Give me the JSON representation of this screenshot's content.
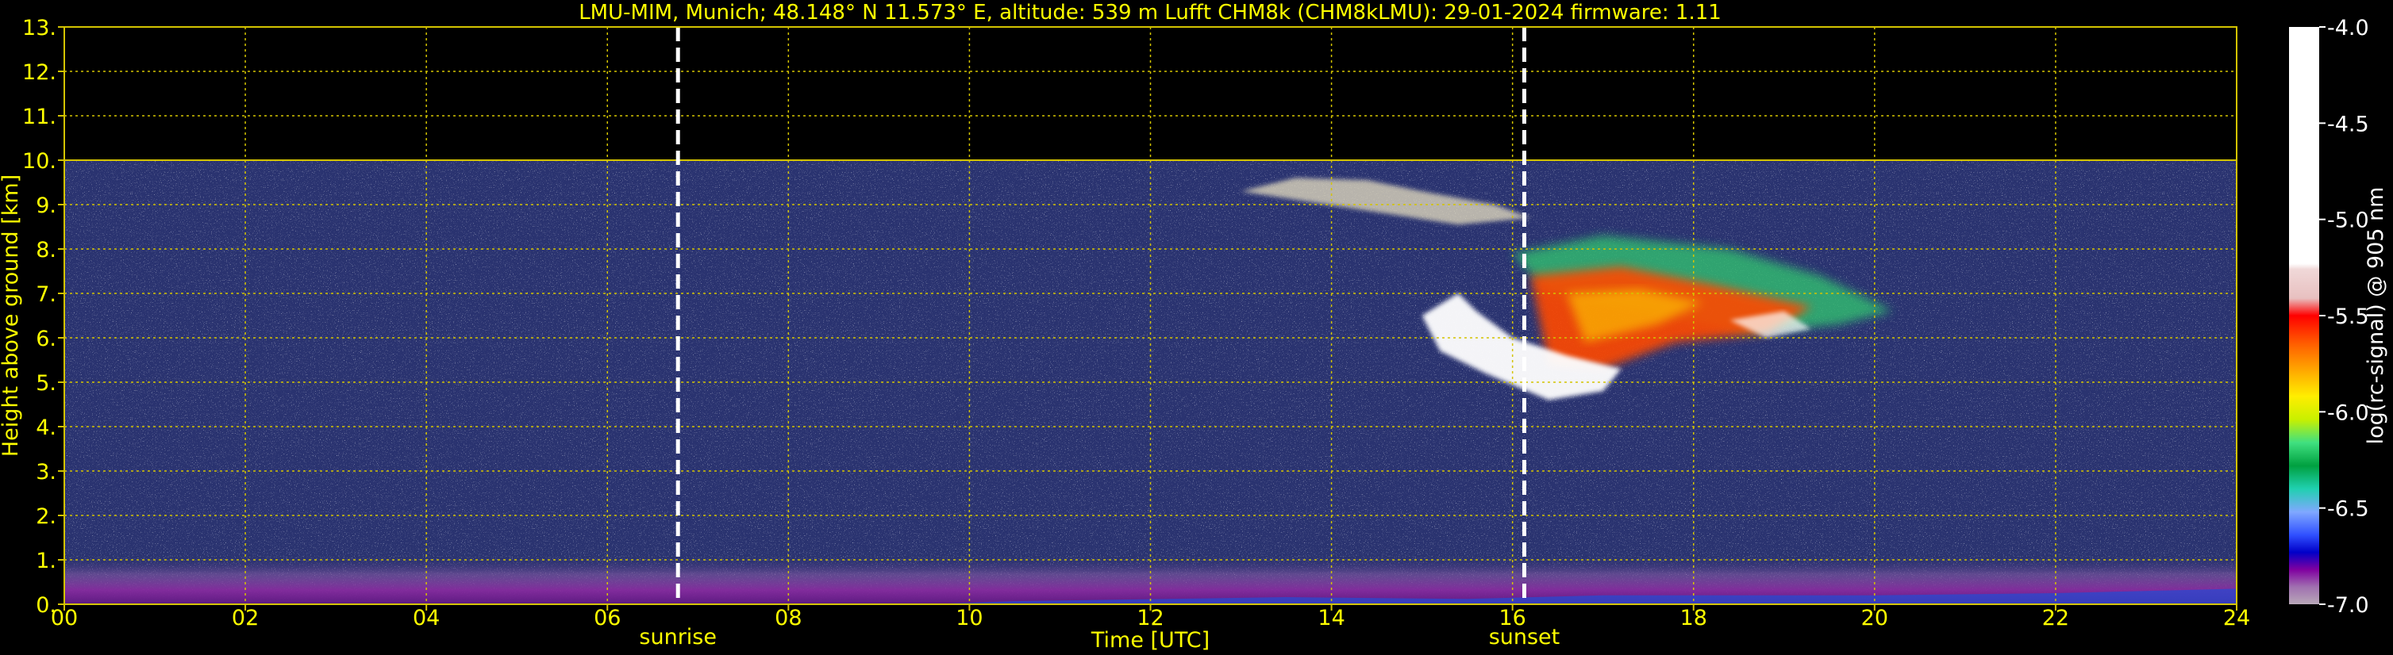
{
  "chart_data": {
    "type": "heatmap",
    "title": "LMU-MIM, Munich; 48.148° N 11.573° E, altitude: 539 m    Lufft CHM8k (CHM8kLMU): 29-01-2024    firmware: 1.11",
    "xlabel": "Time [UTC]",
    "ylabel": "Height above ground [km]",
    "xlim": [
      0,
      24
    ],
    "ylim": [
      0,
      13
    ],
    "x_ticks": [
      "00",
      "02",
      "04",
      "06",
      "08",
      "10",
      "12",
      "14",
      "16",
      "18",
      "20",
      "22",
      "24"
    ],
    "y_ticks": [
      "0.",
      "1.",
      "2.",
      "3.",
      "4.",
      "5.",
      "6.",
      "7.",
      "8.",
      "9.",
      "10.",
      "11.",
      "12.",
      "13."
    ],
    "grid": true,
    "markers": [
      {
        "label": "sunrise",
        "x": 6.78
      },
      {
        "label": "sunset",
        "x": 16.13
      }
    ],
    "data_top_km": 10,
    "colorbar": {
      "label": "log(rc-signal) @ 905 nm",
      "range": [
        -7.0,
        -4.0
      ],
      "ticks": [
        "-4.0",
        "-4.5",
        "-5.0",
        "-5.5",
        "-6.0",
        "-6.5",
        "-7.0"
      ]
    },
    "features": [
      {
        "name": "boundary layer",
        "x_range": [
          0,
          24
        ],
        "height_km": [
          0,
          0.9
        ]
      },
      {
        "name": "cloud upper layer",
        "x_range": [
          13.0,
          16.2
        ],
        "height_km": [
          8.5,
          9.6
        ]
      },
      {
        "name": "cloud main body",
        "x_range": [
          15.0,
          20.2
        ],
        "height_km": [
          4.6,
          8.3
        ]
      }
    ],
    "colors": {
      "grid": "#d4c400",
      "text": "#ffff00",
      "background": "#000000",
      "noise": "#2a3370"
    }
  }
}
